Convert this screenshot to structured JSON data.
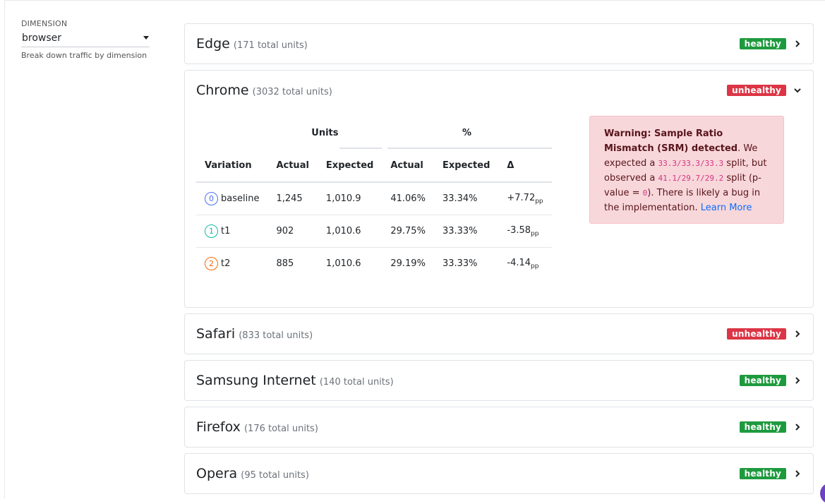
{
  "sidebar": {
    "dimension_label": "DIMENSION",
    "dimension_value": "browser",
    "help": "Break down traffic by dimension"
  },
  "colors": {
    "healthy": "#1e9a3e",
    "unhealthy": "#dc3545",
    "v0": "#4c6ef5",
    "v1": "#12b8a6",
    "v2": "#f76707"
  },
  "dimensions": [
    {
      "name": "Edge",
      "units": "(171 total units)",
      "status": "healthy",
      "expanded": false
    },
    {
      "name": "Chrome",
      "units": "(3032 total units)",
      "status": "unhealthy",
      "expanded": true
    },
    {
      "name": "Safari",
      "units": "(833 total units)",
      "status": "unhealthy",
      "expanded": false
    },
    {
      "name": "Samsung Internet",
      "units": "(140 total units)",
      "status": "healthy",
      "expanded": false
    },
    {
      "name": "Firefox",
      "units": "(176 total units)",
      "status": "healthy",
      "expanded": false
    },
    {
      "name": "Opera",
      "units": "(95 total units)",
      "status": "healthy",
      "expanded": false
    }
  ],
  "table": {
    "group_units": "Units",
    "group_pct": "%",
    "headers": [
      "Variation",
      "Actual",
      "Expected",
      "Actual",
      "Expected",
      "Δ"
    ],
    "rows": [
      {
        "num": "0",
        "name": "baseline",
        "actual": "1,245",
        "expected": "1,010.9",
        "pct_actual": "41.06%",
        "pct_expected": "33.34%",
        "delta": "+7.72",
        "unit": "pp"
      },
      {
        "num": "1",
        "name": "t1",
        "actual": "902",
        "expected": "1,010.6",
        "pct_actual": "29.75%",
        "pct_expected": "33.33%",
        "delta": "-3.58",
        "unit": "pp"
      },
      {
        "num": "2",
        "name": "t2",
        "actual": "885",
        "expected": "1,010.6",
        "pct_actual": "29.19%",
        "pct_expected": "33.33%",
        "delta": "-4.14",
        "unit": "pp"
      }
    ]
  },
  "warning": {
    "title": "Warning: Sample Ratio Mismatch (SRM) detected",
    "t1": ". We expected a ",
    "expected_split": "33.3/33.3/33.3",
    "t2": " split, but observed a ",
    "observed_split": "41.1/29.7/29.2",
    "t3": " split (p-value = ",
    "pvalue": "0",
    "t4": "). There is likely a bug in the implementation. ",
    "link": "Learn More"
  }
}
